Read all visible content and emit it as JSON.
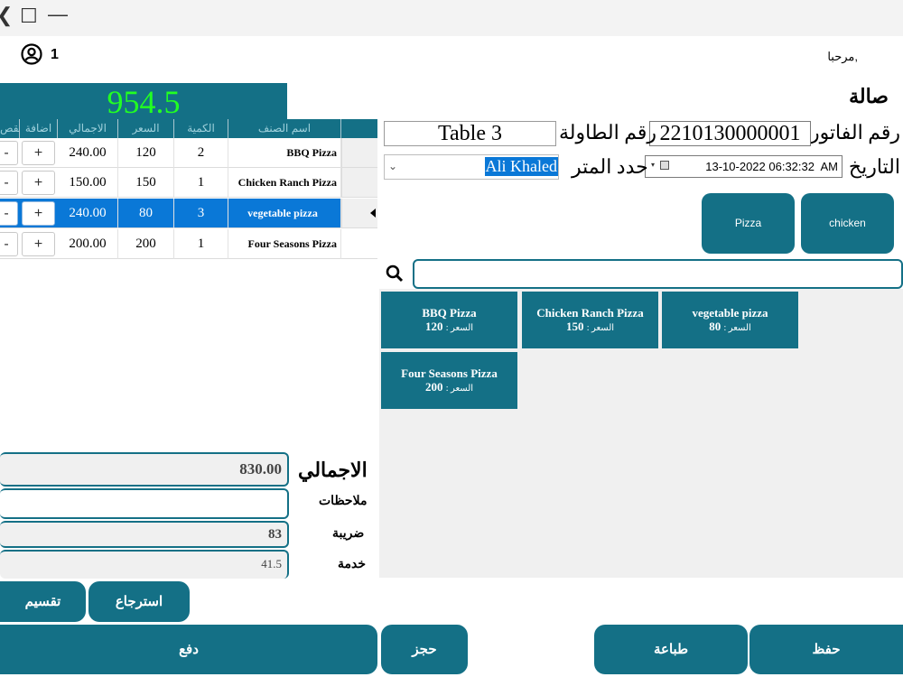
{
  "window": {
    "controls": {
      "back": "❮",
      "maximize": "☐",
      "minimize": "—"
    }
  },
  "user": {
    "count": "1",
    "welcome": "مرحبا,"
  },
  "order_total_display": "954.5",
  "hall_label": "صالة",
  "order_table": {
    "columns": [
      "اسم الصنف",
      "الكمية",
      "السعر",
      "الاجمالي",
      "اضافة",
      "نقص"
    ],
    "rows": [
      {
        "name": "BBQ Pizza",
        "qty": "2",
        "price": "120",
        "total": "240.00",
        "selected": false
      },
      {
        "name": "Chicken Ranch Pizza",
        "qty": "1",
        "price": "150",
        "total": "150.00",
        "selected": false
      },
      {
        "name": "vegetable pizza",
        "qty": "3",
        "price": "80",
        "total": "240.00",
        "selected": true
      },
      {
        "name": "Four Seasons Pizza",
        "qty": "1",
        "price": "200",
        "total": "200.00",
        "selected": false
      }
    ],
    "add_label": "+",
    "remove_label": "-"
  },
  "invoice": {
    "invoice_label": "رقم الفاتورة",
    "invoice_number": "2210130000001",
    "table_label": "رقم الطاولة",
    "table_value": "Table 3",
    "date_label": "التاريخ",
    "date_value": "13-10-2022 06:32:32  AM",
    "waiter_label": "حدد المتر",
    "waiter_value": "Ali Khaled"
  },
  "categories": [
    "chicken",
    "Pizza"
  ],
  "search": {
    "value": "",
    "placeholder": ""
  },
  "products": [
    {
      "name": "BBQ Pizza",
      "price_label": "السعر :",
      "price": "120"
    },
    {
      "name": "Chicken Ranch Pizza",
      "price_label": "السعر :",
      "price": "150"
    },
    {
      "name": "vegetable pizza",
      "price_label": "السعر :",
      "price": "80"
    },
    {
      "name": "Four Seasons Pizza",
      "price_label": "السعر :",
      "price": "200"
    }
  ],
  "summary": {
    "total_label": "الاجمالي",
    "total_value": "830.00",
    "notes_label": "ملاحظات",
    "notes_value": "",
    "tax_label": "ضريبة",
    "tax_value": "83",
    "service_label": "خدمة",
    "service_value": "41.5"
  },
  "actions": {
    "split": "تقسيم",
    "refund": "استرجاع",
    "pay": "دفع",
    "reserve": "حجز",
    "print": "طباعة",
    "save": "حفظ"
  },
  "colors": {
    "accent": "#147086",
    "total_text": "#22ff22",
    "selection": "#0a78d7"
  }
}
